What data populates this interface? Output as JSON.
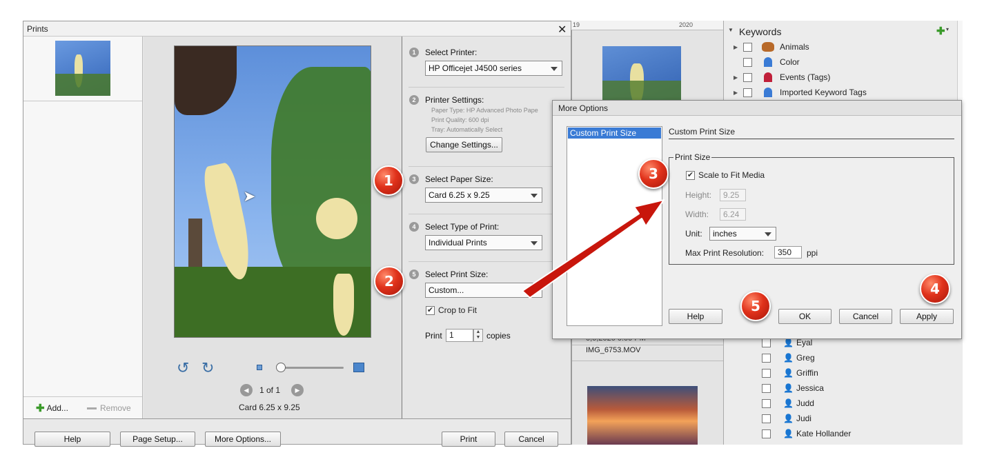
{
  "prints_dialog": {
    "title": "Prints",
    "add_label": "Add...",
    "remove_label": "Remove",
    "page_indicator": "1 of 1",
    "paper_caption": "Card 6.25 x 9.25",
    "buttons": {
      "help": "Help",
      "page_setup": "Page Setup...",
      "more_options": "More Options...",
      "print": "Print",
      "cancel": "Cancel"
    },
    "steps": [
      {
        "num": "1",
        "label": "Select Printer:",
        "value": "HP Officejet J4500 series"
      },
      {
        "num": "2",
        "label": "Printer Settings:",
        "details": [
          "Paper Type: HP Advanced Photo Pape",
          "Print Quality: 600 dpi",
          "Tray:  Automatically Select"
        ],
        "button": "Change Settings..."
      },
      {
        "num": "3",
        "label": "Select Paper Size:",
        "value": "Card 6.25 x 9.25"
      },
      {
        "num": "4",
        "label": "Select Type of Print:",
        "value": "Individual Prints"
      },
      {
        "num": "5",
        "label": "Select Print Size:",
        "value": "Custom..."
      }
    ],
    "crop_to_fit": "Crop to Fit",
    "crop_checked": true,
    "print_label": "Print",
    "copies_value": "1",
    "copies_label": "copies"
  },
  "more_options": {
    "title": "More Options",
    "list_items": [
      "Custom Print Size"
    ],
    "section_heading": "Custom Print Size",
    "group_label": "Print Size",
    "scale_to_fit": "Scale to Fit Media",
    "scale_checked": true,
    "height_label": "Height:",
    "height_value": "9.25",
    "width_label": "Width:",
    "width_value": "6.24",
    "unit_label": "Unit:",
    "unit_value": "inches",
    "res_label": "Max Print Resolution:",
    "res_value": "350",
    "res_unit": "ppi",
    "buttons": {
      "help": "Help",
      "ok": "OK",
      "cancel": "Cancel",
      "apply": "Apply"
    }
  },
  "organizer": {
    "year_left": "19",
    "year_right": "2020",
    "file_name": "IMG_6753.MOV",
    "partial_date": "0,0,2020 0.00 PM"
  },
  "keywords": {
    "title": "Keywords",
    "categories": [
      "Animals",
      "Color",
      "Events (Tags)",
      "Imported Keyword Tags"
    ],
    "people": [
      "Eyal",
      "Greg",
      "Griffin",
      "Jessica",
      "Judd",
      "Judi",
      "Kate Hollander"
    ]
  },
  "callouts": [
    "1",
    "2",
    "3",
    "4",
    "5"
  ],
  "colors": {
    "callout_red": "#d9301a",
    "arrow_red": "#c8160c",
    "list_selection": "#3a7bd5"
  }
}
